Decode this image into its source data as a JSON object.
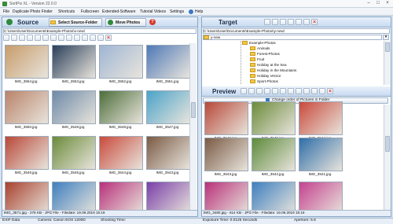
{
  "window": {
    "title": "SortPix XL - Version 22.0.0"
  },
  "menu": [
    "File",
    "Duplicate Photo Finder",
    "Shortcuts",
    "Fullscreen",
    "Extended-Software",
    "Tutorial Videos",
    "Settings",
    "Help"
  ],
  "source": {
    "title": "Source",
    "select_folder_label": "Select Source-Folder",
    "move_photos_label": "Move Photos",
    "path": "C:\\Users\\User\\Documents\\Example-Photos\\x-new\\",
    "thumbnails": [
      {
        "label": "IMG_3554.jpg",
        "color": "#c79c6b"
      },
      {
        "label": "IMG_3553.jpg",
        "color": "#2a3f5a"
      },
      {
        "label": "IMG_3552.jpg",
        "color": "#9fb6d4"
      },
      {
        "label": "IMG_3551.jpg",
        "color": "#4f79b7"
      },
      {
        "label": "IMG_3550.jpg",
        "color": "#b9836a"
      },
      {
        "label": "IMG_3549.jpg",
        "color": "#6d8aa8"
      },
      {
        "label": "IMG_3548.jpg",
        "color": "#4d6e3a"
      },
      {
        "label": "IMG_3547.jpg",
        "color": "#4aa3c9"
      },
      {
        "label": "IMG_3546.jpg",
        "color": "#b84838"
      },
      {
        "label": "IMG_3545.jpg",
        "color": "#6b8b3a"
      },
      {
        "label": "IMG_3544.jpg",
        "color": "#c94a3c"
      },
      {
        "label": "IMG_3543.jpg",
        "color": "#7a5a44"
      },
      {
        "label": "",
        "color": "#a8412e"
      },
      {
        "label": "",
        "color": "#3e7fbf"
      },
      {
        "label": "",
        "color": "#b8317a"
      },
      {
        "label": "",
        "color": "#7a3fa8"
      }
    ],
    "status": "IMG_3571.jpg - 276 KB - JPG File - Filedate: 19.09.2019 15:19"
  },
  "target": {
    "title": "Target",
    "path": "C:\\Users\\User\\Documents\\Example-Photos\\y-new\\",
    "dropdown_value": "y-new",
    "tree_root": "Example-Photos",
    "tree_items": [
      "Animals",
      "Forest-Photos",
      "Fruit",
      "Holiday at the Sea",
      "Holiday in the Mountains",
      "Holiday Venice",
      "Sport-Photos"
    ]
  },
  "preview": {
    "title": "Preview",
    "change_order_label": "Change order of Pictures in Folder",
    "thumbnails": [
      {
        "label": "IMG_3546.jpg",
        "color": "#b84838"
      },
      {
        "label": "IMG_3545.jpg",
        "color": "#6b8b3a"
      },
      {
        "label": "IMG_3544.jpg",
        "color": "#c94a3c"
      },
      {
        "label": "IMG_3543.jpg",
        "color": "#7a5a44"
      },
      {
        "label": "IMG_3542.jpg",
        "color": "#5d8a3a"
      },
      {
        "label": "IMG_3541.jpg",
        "color": "#2f6ea8"
      },
      {
        "label": "",
        "color": "#b8317a"
      },
      {
        "label": "",
        "color": "#3e7fbf"
      },
      {
        "label": "",
        "color": "#c4428f"
      }
    ],
    "status": "IMG_3480.jpg - 614 KB - JPG File - Filedate: 19.09.2019 15:19"
  },
  "exif": {
    "label": "EXIF Data",
    "camera": "Camera: Canon EOS 1200D",
    "shooting_time": "Shooting Time:",
    "exposure": "Exposure Time: 0.0125 Seconds",
    "aperture": "Aperture: 5.6"
  },
  "colors": {
    "accent": "#c8daf0",
    "border": "#8aa6c6",
    "background": "#d4e2f2"
  }
}
